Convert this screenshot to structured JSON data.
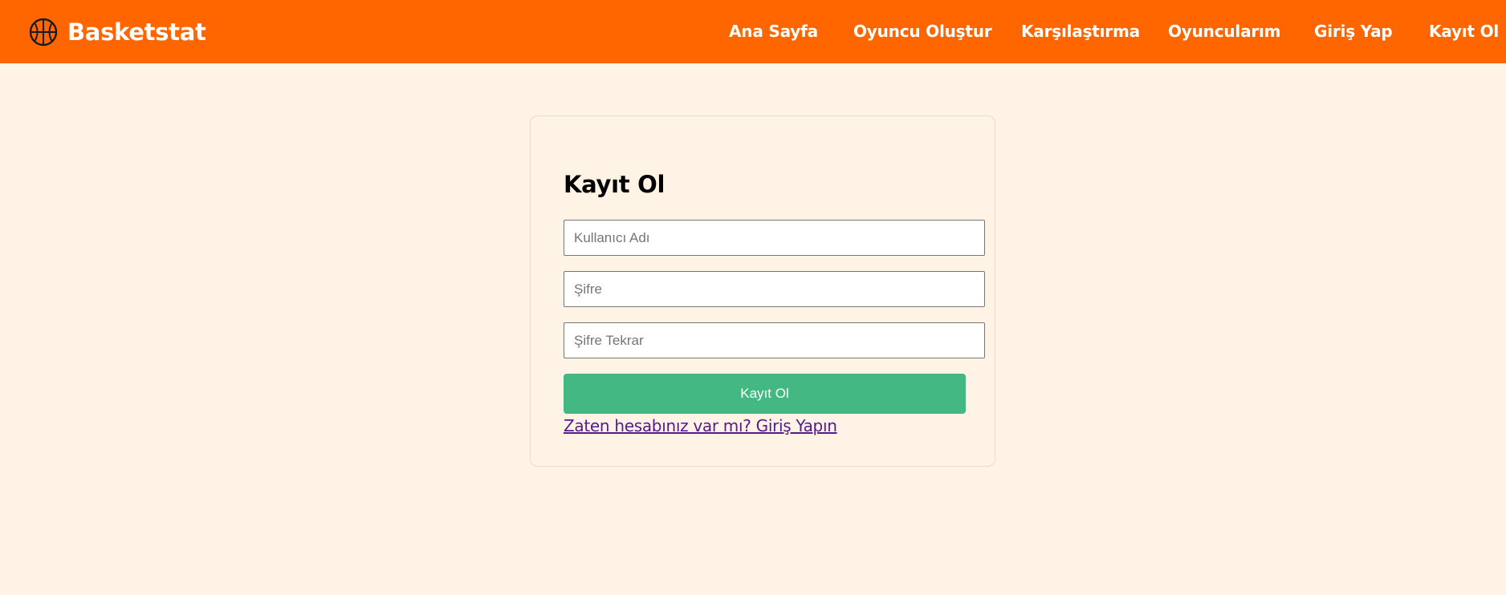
{
  "brand": {
    "name": "Basketstat",
    "icon": "basketball-icon"
  },
  "nav": {
    "items": [
      {
        "label": "Ana Sayfa"
      },
      {
        "label": "Oyuncu Oluştur"
      },
      {
        "label": "Karşılaştırma"
      },
      {
        "label": "Oyuncularım"
      },
      {
        "label": "Giriş Yap"
      },
      {
        "label": "Kayıt Ol"
      }
    ]
  },
  "form": {
    "title": "Kayıt Ol",
    "username": {
      "placeholder": "Kullanıcı Adı",
      "value": ""
    },
    "password": {
      "placeholder": "Şifre",
      "value": ""
    },
    "password_confirm": {
      "placeholder": "Şifre Tekrar",
      "value": ""
    },
    "submit_label": "Kayıt Ol",
    "login_link": "Zaten hesabınız var mı? Giriş Yapın"
  },
  "colors": {
    "navbar": "#ff6600",
    "background": "#fef3e4",
    "submit_button": "#43b883",
    "link": "#551a8b"
  }
}
